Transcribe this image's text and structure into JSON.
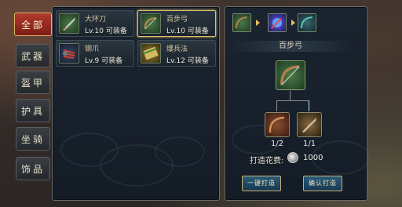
{
  "tabs": [
    "全部",
    "武器",
    "盔甲",
    "护具",
    "坐骑",
    "饰品"
  ],
  "active_tab": 0,
  "items": [
    {
      "name": "大环刀",
      "level": "Lv.10 可装备",
      "icon": "sword-icon",
      "color": "#3a6a40"
    },
    {
      "name": "百步弓",
      "level": "Lv.10 可装备",
      "icon": "bow-icon",
      "color": "#3a6a40",
      "selected": true
    },
    {
      "name": "钢爪",
      "level": "Lv.9 可装备",
      "icon": "claw-icon",
      "color": "#2a3a5a"
    },
    {
      "name": "爆兵法",
      "level": "Lv.12 可装备",
      "icon": "scroll-icon",
      "color": "#6a5a20"
    }
  ],
  "detail": {
    "title": "百步弓",
    "path_icons": [
      "bow-icon",
      "orb-icon",
      "bow-upgrade-icon"
    ],
    "materials": [
      {
        "icon": "bow-material-icon",
        "count": "1/2"
      },
      {
        "icon": "blade-material-icon",
        "count": "1/1"
      }
    ],
    "cost_label": "打造花费:",
    "cost_icon": "silver-coin-icon",
    "cost_value": "1000",
    "btn_quick": "一键打造",
    "btn_confirm": "确认打造"
  }
}
